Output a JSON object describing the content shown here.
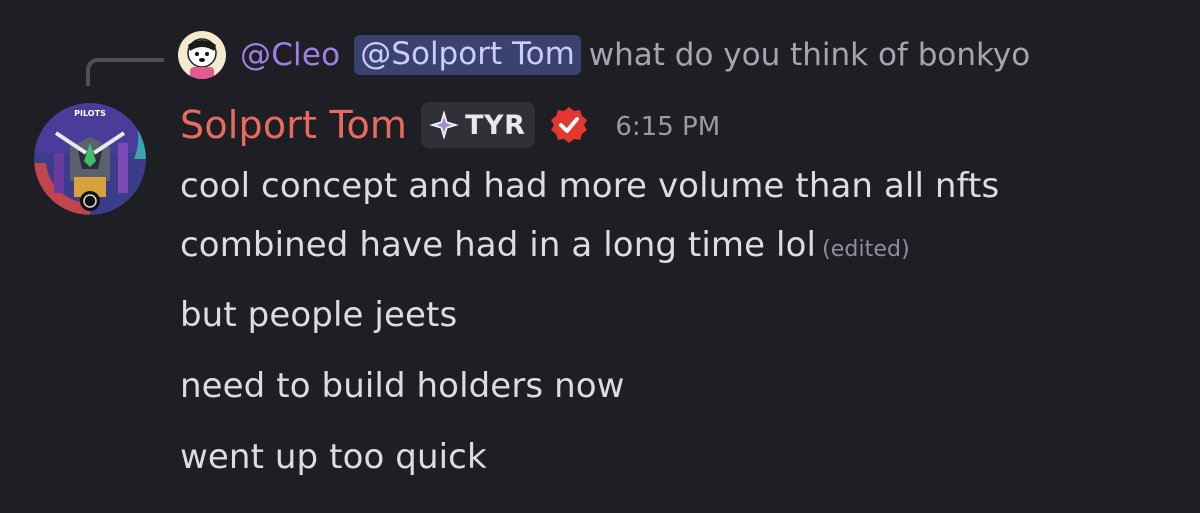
{
  "reply": {
    "author": "@Cleo",
    "mention": "@Solport Tom",
    "text": "what do you think of bonkyo"
  },
  "message": {
    "username": "Solport Tom",
    "tag": "TYR",
    "timestamp": "6:15 PM",
    "avatar_badge_text": "PILOTS",
    "lines": [
      "cool concept  and had more volume than all nfts",
      "combined have had in a long time lol",
      "but people jeets",
      "need to build holders now",
      "went up too quick"
    ],
    "edited_label": "(edited)"
  },
  "icons": {
    "tag_icon": "sparkle-icon",
    "verified_icon": "verified-badge-icon"
  },
  "colors": {
    "background": "#1e1f24",
    "username": "#ea6a5e",
    "reply_author": "#9f7fe6",
    "mention_bg": "#3c4270",
    "verified": "#e5372f"
  }
}
